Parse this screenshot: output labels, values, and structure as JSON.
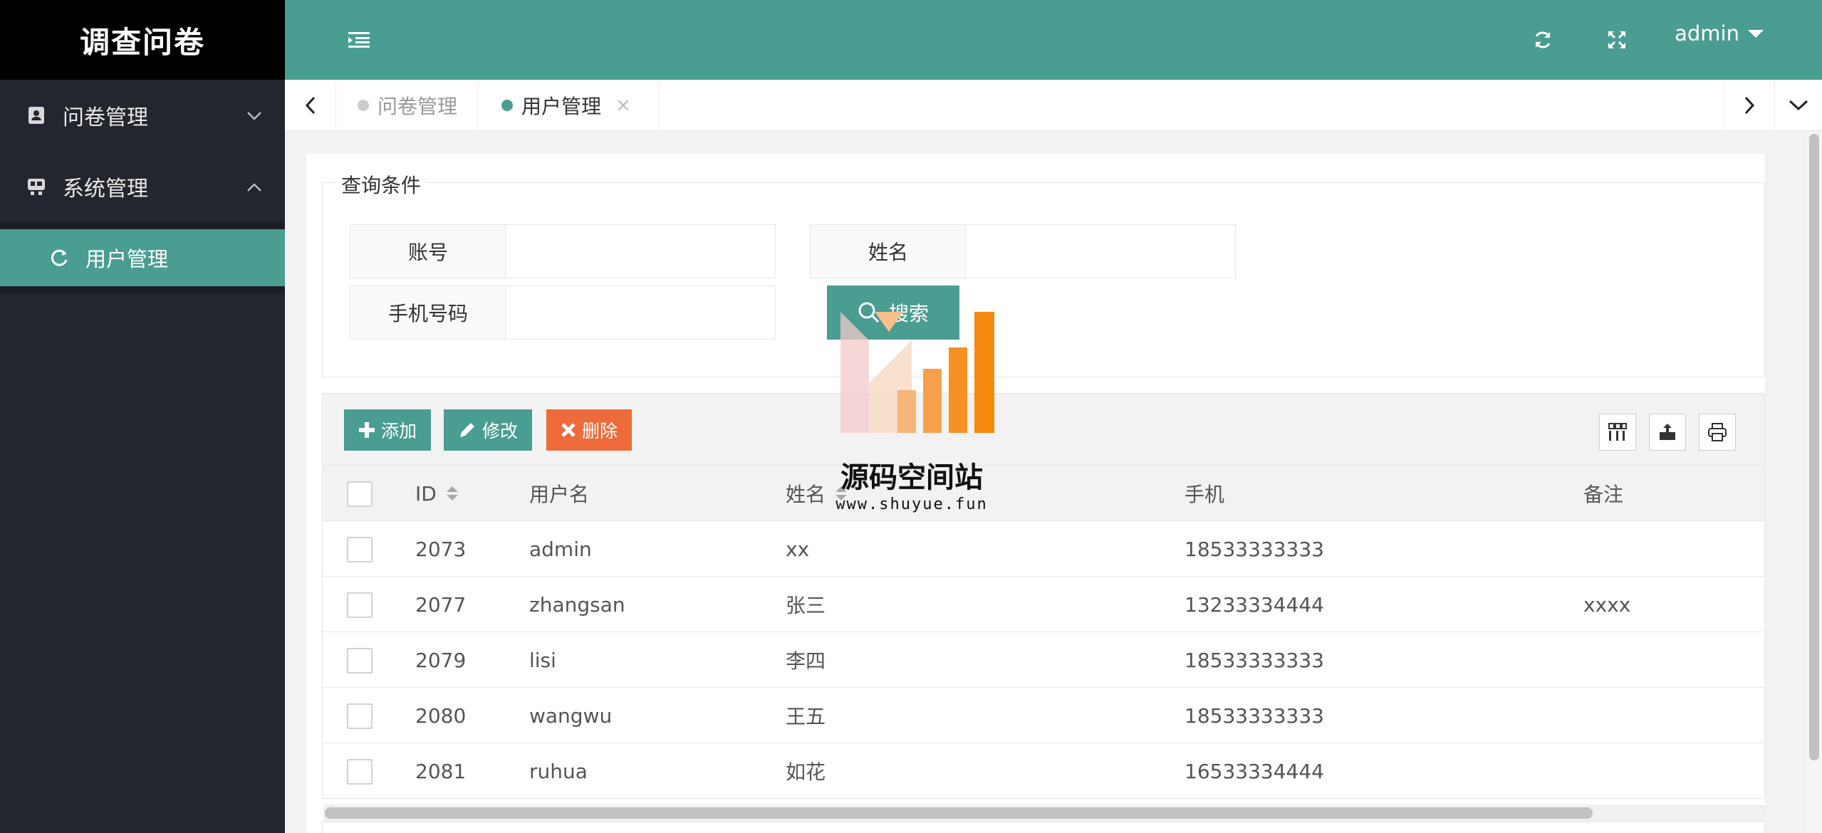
{
  "app": {
    "title": "调查问卷"
  },
  "sidebar": {
    "items": [
      {
        "label": "问卷管理",
        "icon": "contacts-book-icon",
        "expanded": false
      },
      {
        "label": "系统管理",
        "icon": "system-gear-icon",
        "expanded": true
      }
    ],
    "sub_items": [
      {
        "label": "用户管理",
        "icon": "refresh-circle-icon",
        "active": true
      }
    ]
  },
  "header": {
    "menu_toggle_icon": "indent-icon",
    "refresh_icon": "refresh-icon",
    "fullscreen_icon": "fullscreen-icon",
    "user": "admin"
  },
  "tabs": [
    {
      "label": "问卷管理",
      "active": false
    },
    {
      "label": "用户管理",
      "active": true,
      "close": "×"
    }
  ],
  "query": {
    "legend": "查询条件",
    "fields": [
      {
        "label": "账号",
        "value": "",
        "placeholder": ""
      },
      {
        "label": "姓名",
        "value": "",
        "placeholder": ""
      },
      {
        "label": "手机号码",
        "value": "",
        "placeholder": ""
      }
    ],
    "search_label": "搜索"
  },
  "toolbar": {
    "add_label": "添加",
    "edit_label": "修改",
    "delete_label": "删除"
  },
  "table": {
    "columns": [
      "ID",
      "用户名",
      "姓名",
      "手机",
      "备注"
    ],
    "rows": [
      {
        "id": "2073",
        "username": "admin",
        "name": "xx",
        "phone": "18533333333",
        "remark": ""
      },
      {
        "id": "2077",
        "username": "zhangsan",
        "name": "张三",
        "phone": "13233334444",
        "remark": "xxxx"
      },
      {
        "id": "2079",
        "username": "lisi",
        "name": "李四",
        "phone": "18533333333",
        "remark": ""
      },
      {
        "id": "2080",
        "username": "wangwu",
        "name": "王五",
        "phone": "18533333333",
        "remark": ""
      },
      {
        "id": "2081",
        "username": "ruhua",
        "name": "如花",
        "phone": "16533334444",
        "remark": ""
      }
    ]
  },
  "watermark": {
    "title": "源码空间站",
    "url": "www.shuyue.fun"
  },
  "colors": {
    "accent": "#4a9d91",
    "sidebar": "#23262e",
    "danger": "#ee6a3a"
  }
}
